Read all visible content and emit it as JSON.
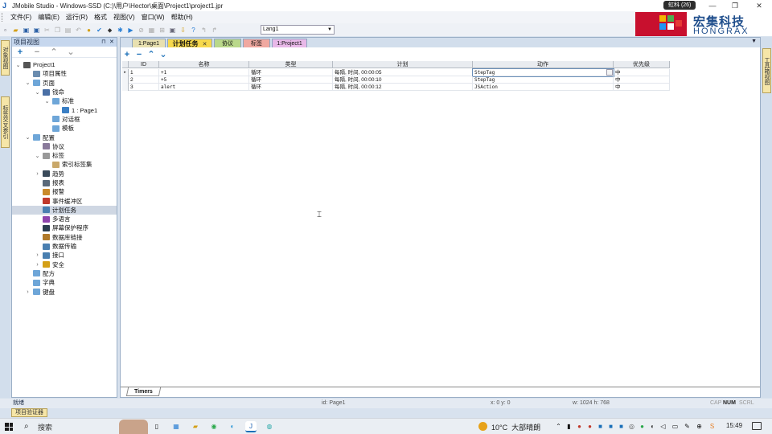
{
  "window": {
    "title": "JMobile Studio - Windows-SSD (C:)\\用户\\Hector\\桌面\\Project1\\project1.jpr",
    "notification_badge": "虹科 (26)"
  },
  "menu": [
    "文件(F)",
    "编辑(E)",
    "运行(R)",
    "格式",
    "视图(V)",
    "窗口(W)",
    "帮助(H)"
  ],
  "toolbar": {
    "language_value": "Lang1"
  },
  "brand": {
    "name_cn": "宏集科技",
    "name_en": "HONGRAX"
  },
  "side_tabs": {
    "left": [
      "对象视图",
      "标签交叉参引"
    ],
    "right": [
      "工具箱视图"
    ]
  },
  "project_panel": {
    "title": "项目视图",
    "tree": [
      {
        "label": "Project1",
        "level": 0,
        "expander": "v",
        "icon": "computer-icon",
        "color": "#555"
      },
      {
        "label": "项目属性",
        "level": 1,
        "expander": "",
        "icon": "properties-icon",
        "color": "#6a8caf"
      },
      {
        "label": "页面",
        "level": 1,
        "expander": "v",
        "icon": "folder-icon",
        "color": "#6ea6d8"
      },
      {
        "label": "钱命",
        "level": 2,
        "expander": "v",
        "icon": "page-icon",
        "color": "#4a6fa5"
      },
      {
        "label": "标准",
        "level": 3,
        "expander": "v",
        "icon": "folder-icon",
        "color": "#6ea6d8"
      },
      {
        "label": "1 : Page1",
        "level": 4,
        "expander": "",
        "icon": "home-icon",
        "color": "#3b7fc4"
      },
      {
        "label": "对话框",
        "level": 3,
        "expander": "",
        "icon": "folder-icon",
        "color": "#6ea6d8"
      },
      {
        "label": "模板",
        "level": 3,
        "expander": "",
        "icon": "folder-icon",
        "color": "#6ea6d8"
      },
      {
        "label": "配置",
        "level": 1,
        "expander": "v",
        "icon": "folder-icon",
        "color": "#6ea6d8"
      },
      {
        "label": "协议",
        "level": 2,
        "expander": "",
        "icon": "protocol-icon",
        "color": "#8a7a9a"
      },
      {
        "label": "标签",
        "level": 2,
        "expander": "v",
        "icon": "tag-icon",
        "color": "#999"
      },
      {
        "label": "索引标签集",
        "level": 3,
        "expander": "",
        "icon": "tagset-icon",
        "color": "#c9a86a"
      },
      {
        "label": "趋势",
        "level": 2,
        "expander": ">",
        "icon": "trend-icon",
        "color": "#3a4a5a"
      },
      {
        "label": "报表",
        "level": 2,
        "expander": "",
        "icon": "report-icon",
        "color": "#5a6a7a"
      },
      {
        "label": "报警",
        "level": 2,
        "expander": "",
        "icon": "alarm-icon",
        "color": "#c98a2a"
      },
      {
        "label": "事件缓冲区",
        "level": 2,
        "expander": "",
        "icon": "pin-icon",
        "color": "#c0392b"
      },
      {
        "label": "计划任务",
        "level": 2,
        "expander": "",
        "icon": "scheduler-icon",
        "color": "#4a7fb0",
        "selected": true
      },
      {
        "label": "多语言",
        "level": 2,
        "expander": "",
        "icon": "language-icon",
        "color": "#8e44ad"
      },
      {
        "label": "屏幕保护程序",
        "level": 2,
        "expander": "",
        "icon": "screensaver-icon",
        "color": "#2c3e50"
      },
      {
        "label": "数据库链接",
        "level": 2,
        "expander": "",
        "icon": "database-icon",
        "color": "#b07a2a"
      },
      {
        "label": "数据传输",
        "level": 2,
        "expander": "",
        "icon": "transfer-icon",
        "color": "#4a7fb0"
      },
      {
        "label": "接口",
        "level": 2,
        "expander": ">",
        "icon": "interface-icon",
        "color": "#4a7fb0"
      },
      {
        "label": "安全",
        "level": 2,
        "expander": ">",
        "icon": "lock-icon",
        "color": "#d4a017"
      },
      {
        "label": "配方",
        "level": 1,
        "expander": "",
        "icon": "folder-icon",
        "color": "#6ea6d8"
      },
      {
        "label": "字典",
        "level": 1,
        "expander": "",
        "icon": "folder-icon",
        "color": "#6ea6d8"
      },
      {
        "label": "键盘",
        "level": 1,
        "expander": ">",
        "icon": "folder-icon",
        "color": "#6ea6d8"
      }
    ]
  },
  "doc_tabs": [
    {
      "label": "1:Page1",
      "bg": "#e8e0b0",
      "active": false,
      "closable": false
    },
    {
      "label": "计划任务",
      "bg": "#f7d94c",
      "active": true,
      "closable": true
    },
    {
      "label": "协议",
      "bg": "#b9d88a",
      "active": false,
      "closable": false
    },
    {
      "label": "标签",
      "bg": "#f0a8a0",
      "active": false,
      "closable": false
    },
    {
      "label": "1:Project1",
      "bg": "#e8b8e8",
      "active": false,
      "closable": false
    }
  ],
  "grid": {
    "columns": [
      "ID",
      "名称",
      "类型",
      "计划",
      "动作",
      "优先级"
    ],
    "rows": [
      {
        "indicator": "▸",
        "id": "1",
        "name": "+1",
        "type": "循环",
        "schedule": "每隔, 时间, 00:00:05",
        "action": "StepTag",
        "priority": "中"
      },
      {
        "indicator": "",
        "id": "2",
        "name": "+5",
        "type": "循环",
        "schedule": "每隔, 时间, 00:00:10",
        "action": "StepTag",
        "priority": "中"
      },
      {
        "indicator": "",
        "id": "3",
        "name": "alert",
        "type": "循环",
        "schedule": "每隔, 时间, 00:00:12",
        "action": "JSAction",
        "priority": "中"
      }
    ],
    "sheet_tab": "Timers"
  },
  "statusbar": {
    "ready": "就绪",
    "id": "id: Page1",
    "xy": "x: 0 y: 0",
    "wh": "w: 1024 h: 768",
    "caps": "CAP",
    "num": "NUM",
    "scrl": "SCRL",
    "bottom_panel_tab": "项目验证器"
  },
  "taskbar": {
    "search_label": "搜索",
    "temperature": "10°C",
    "weather": "大部晴朗",
    "time": "15:49"
  }
}
